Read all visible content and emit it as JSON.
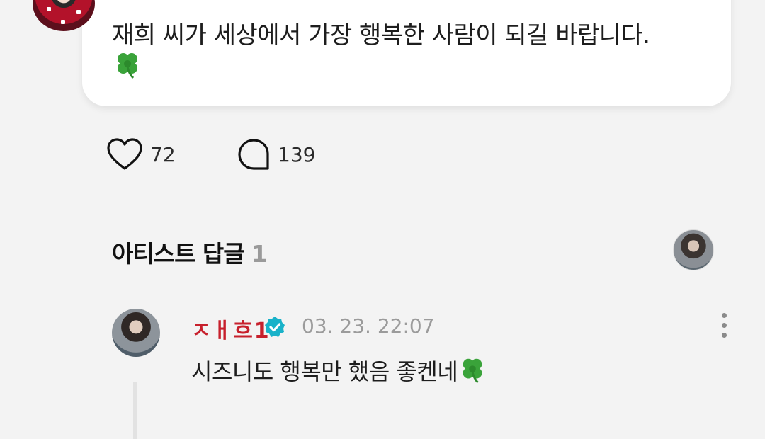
{
  "post": {
    "text": "재희 씨가 세상에서 가장 행복한 사람이 되길 바랍니다.",
    "emoji": "four-leaf-clover"
  },
  "actions": {
    "like_count": "72",
    "comment_count": "139"
  },
  "artist_replies": {
    "title": "아티스트 답글",
    "count": "1"
  },
  "reply": {
    "author": "ㅈㅐ흐1",
    "time": "03. 23. 22:07",
    "text": "시즈니도 행복만 했음 좋켄네",
    "verified": true
  },
  "colors": {
    "background": "#f3f3f3",
    "author_name": "#c7202c",
    "verified_badge": "#19b2c9"
  }
}
